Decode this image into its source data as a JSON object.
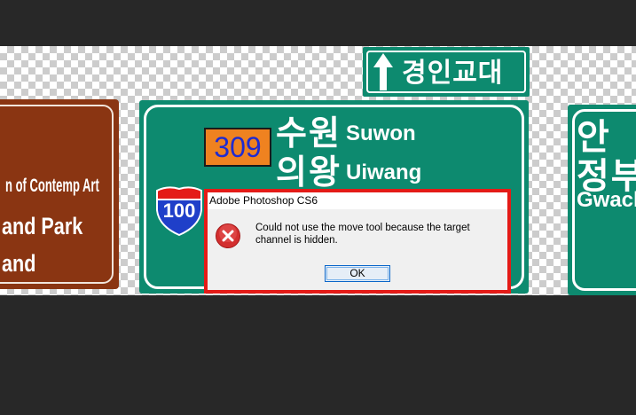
{
  "brown_sign": {
    "line1": "n of Contemp Art",
    "line2": "and Park",
    "line3": "and"
  },
  "top_sign": {
    "text": "경인교대"
  },
  "main_sign": {
    "route_number": "309",
    "city1_ko": "수원",
    "city1_en": "Suwon",
    "city2_ko": "의왕",
    "city2_en": "Uiwang",
    "shield_number": "100"
  },
  "right_sign": {
    "line1_ko": "안",
    "line2_ko": "정부",
    "line3_en": "Gwache"
  },
  "dialog": {
    "title": "Adobe Photoshop CS6",
    "message": "Could not use the move tool because the target channel is hidden.",
    "ok_label": "OK"
  },
  "colors": {
    "workspace": "#282828",
    "sign_green": "#0d8a6f",
    "sign_brown": "#8a3512",
    "route_orange": "#ef8220",
    "highlight_red": "#e41b17"
  },
  "icons": {
    "dialog": "error-icon",
    "top_sign": "arrow-up-icon",
    "route_shield": "interstate-shield-icon"
  }
}
